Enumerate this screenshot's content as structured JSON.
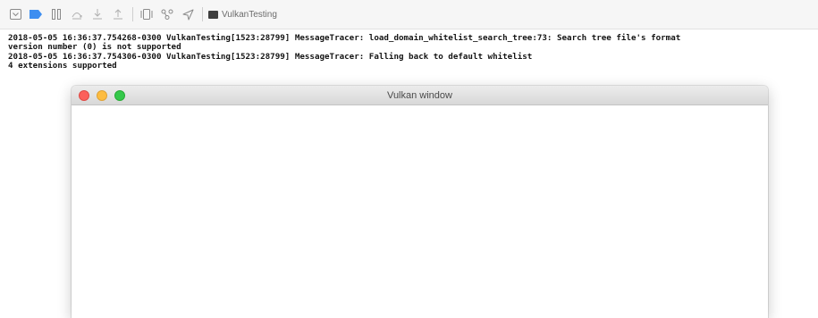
{
  "toolbar": {
    "target_name": "VulkanTesting",
    "buttons": [
      {
        "icon": "hide-debug-area-icon"
      },
      {
        "icon": "breakpoints-active-icon",
        "color": "#3d8ef0"
      },
      {
        "icon": "pause-icon"
      },
      {
        "icon": "step-over-icon"
      },
      {
        "icon": "step-into-icon"
      },
      {
        "icon": "step-out-icon"
      },
      {
        "icon": "debug-view-hierarchy-icon"
      },
      {
        "icon": "memory-graph-icon"
      },
      {
        "icon": "simulate-location-icon"
      }
    ]
  },
  "console": {
    "lines": [
      "2018-05-05 16:36:37.754268-0300 VulkanTesting[1523:28799] MessageTracer: load_domain_whitelist_search_tree:73: Search tree file's format",
      "version number (0) is not supported",
      "2018-05-05 16:36:37.754306-0300 VulkanTesting[1523:28799] MessageTracer: Falling back to default whitelist",
      "4 extensions supported"
    ]
  },
  "window": {
    "title": "Vulkan window",
    "colors": {
      "close": "#fc605b",
      "minimize": "#fdbc40",
      "zoom": "#34c84a"
    }
  }
}
